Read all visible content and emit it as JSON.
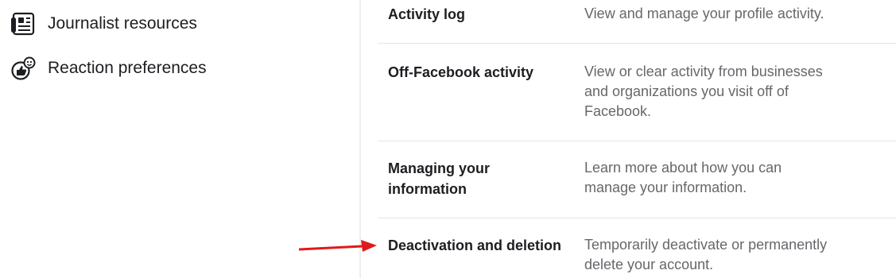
{
  "sidebar": {
    "items": [
      {
        "label": "Journalist resources",
        "icon": "newspaper-icon"
      },
      {
        "label": "Reaction preferences",
        "icon": "reaction-icon"
      }
    ]
  },
  "settings": {
    "rows": [
      {
        "title": "Activity log",
        "description": "View and manage your profile activity."
      },
      {
        "title": "Off-Facebook activity",
        "description": "View or clear activity from businesses and organizations you visit off of Facebook."
      },
      {
        "title": "Managing your information",
        "description": "Learn more about how you can manage your information."
      },
      {
        "title": "Deactivation and deletion",
        "description": "Temporarily deactivate or permanently delete your account."
      }
    ]
  },
  "annotation": {
    "arrow_color": "#e0191b"
  }
}
